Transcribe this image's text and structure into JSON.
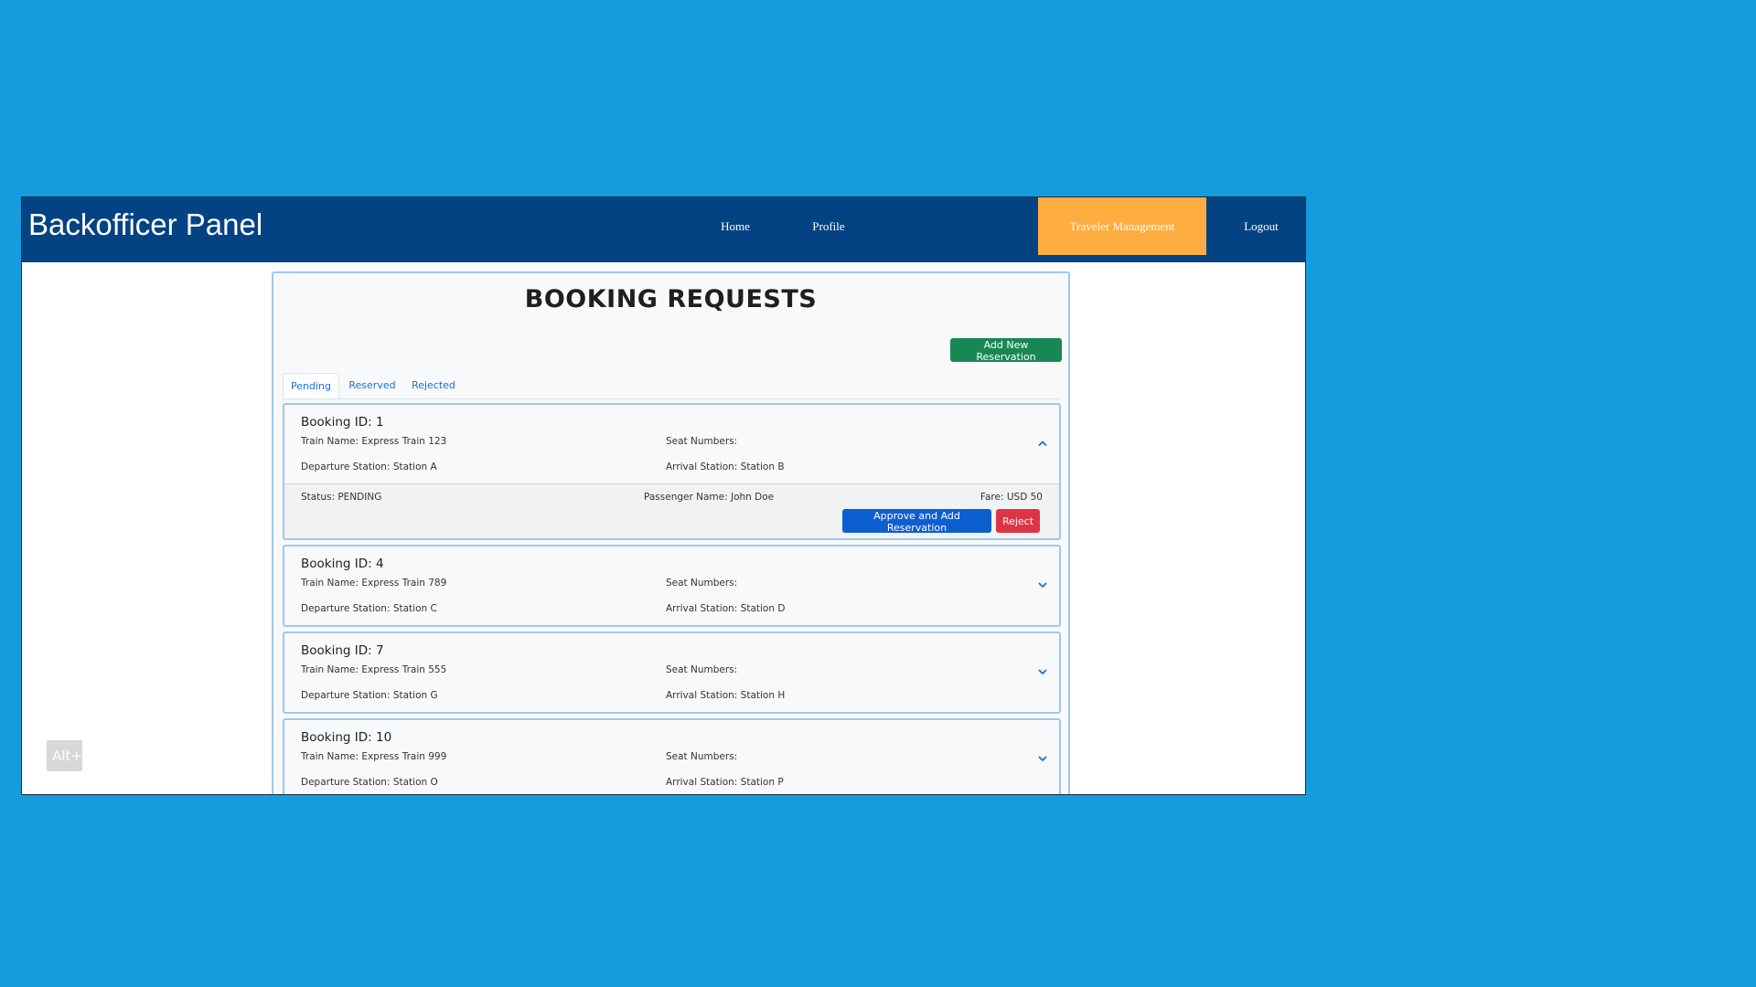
{
  "app": {
    "brand": "Backofficer Panel"
  },
  "nav": {
    "home": "Home",
    "profile": "Profile",
    "traveler_management": "Traveler Management",
    "logout": "Logout"
  },
  "page": {
    "title": "BOOKING REQUESTS",
    "add_button": "Add New Reservation"
  },
  "tabs": [
    {
      "label": "Pending",
      "active": true
    },
    {
      "label": "Reserved",
      "active": false
    },
    {
      "label": "Rejected",
      "active": false
    }
  ],
  "bookings": [
    {
      "id_label": "Booking ID: 1",
      "train": "Train Name: Express Train 123",
      "seats": "Seat Numbers:",
      "departure": "Departure Station: Station A",
      "arrival": "Arrival Station: Station B",
      "expanded": true,
      "status": "Status: PENDING",
      "passenger": "Passenger Name: John Doe",
      "fare": "Fare: USD 50",
      "approve_label": "Approve and Add Reservation",
      "reject_label": "Reject"
    },
    {
      "id_label": "Booking ID: 4",
      "train": "Train Name: Express Train 789",
      "seats": "Seat Numbers:",
      "departure": "Departure Station: Station C",
      "arrival": "Arrival Station: Station D",
      "expanded": false
    },
    {
      "id_label": "Booking ID: 7",
      "train": "Train Name: Express Train 555",
      "seats": "Seat Numbers:",
      "departure": "Departure Station: Station G",
      "arrival": "Arrival Station: Station H",
      "expanded": false
    },
    {
      "id_label": "Booking ID: 10",
      "train": "Train Name: Express Train 999",
      "seats": "Seat Numbers:",
      "departure": "Departure Station: Station O",
      "arrival": "Arrival Station: Station P",
      "expanded": false
    }
  ],
  "overlay": {
    "hint": "Alt+"
  },
  "colors": {
    "desktop_bg": "#159cdc",
    "navbar": "#034384",
    "nav_active": "#ffac41",
    "success": "#198754",
    "primary": "#0d5fd0",
    "danger": "#dc3545",
    "link": "#1e6fd9"
  },
  "icons": {
    "expanded": "chevron-up-icon",
    "collapsed": "chevron-down-icon"
  }
}
